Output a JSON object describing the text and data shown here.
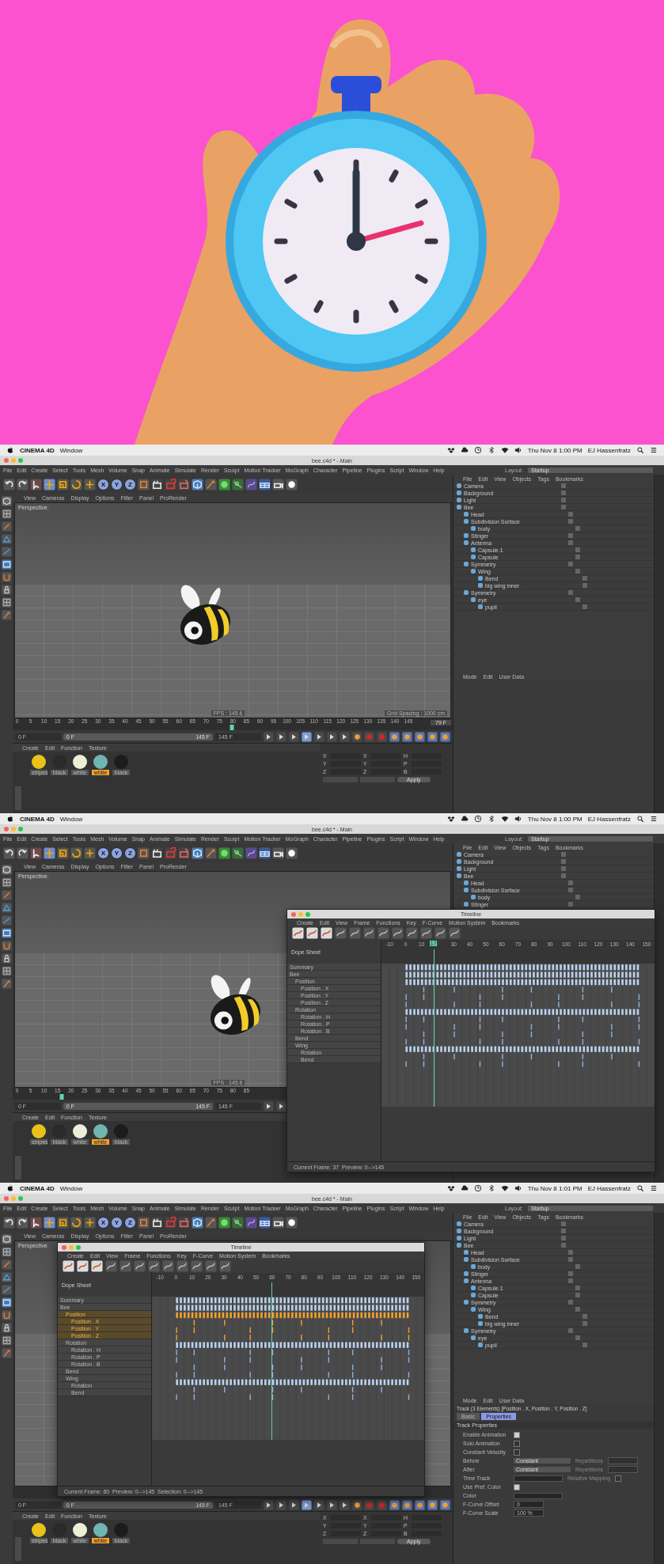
{
  "screens": [
    {
      "system_bar": {
        "app": "CINEMA 4D",
        "menu": "Window",
        "clock": "Thu Nov 8  1:00 PM",
        "user": "EJ Hassenfratz"
      },
      "title": "bee.c4d * - Main",
      "menus": [
        "File",
        "Edit",
        "Create",
        "Select",
        "Tools",
        "Mesh",
        "Volume",
        "Snap",
        "Animate",
        "Simulate",
        "Render",
        "Sculpt",
        "Motion Tracker",
        "MoGraph",
        "Character",
        "Pipeline",
        "Plugins",
        "Script",
        "Window",
        "Help"
      ],
      "layout": {
        "label": "Layout:",
        "value": "Startup"
      },
      "axis_buttons": [
        "X",
        "Y",
        "Z"
      ],
      "viewport": {
        "menus": [
          "View",
          "Cameras",
          "Display",
          "Options",
          "Filter",
          "Panel",
          "ProRender"
        ],
        "camera": "Perspective",
        "fps": "FPS : 145.6",
        "grid": "Grid Spacing : 1000 cm"
      },
      "ruler": {
        "ticks": [
          "0",
          "5",
          "10",
          "15",
          "20",
          "25",
          "30",
          "35",
          "40",
          "45",
          "50",
          "55",
          "60",
          "65",
          "70",
          "75",
          "80",
          "85",
          "90",
          "95",
          "100",
          "105",
          "110",
          "115",
          "120",
          "125",
          "130",
          "135",
          "140",
          "145"
        ],
        "current": "79 F",
        "level": 0.53
      },
      "transport": {
        "start": "0 F",
        "range_start": "0 F",
        "range_end": "145 F",
        "end": "145 F",
        "level": 1
      },
      "materials": {
        "menus": [
          "Create",
          "Edit",
          "Function",
          "Texture"
        ],
        "items": [
          {
            "name": "stripes",
            "color": "#e8c21a",
            "selected": false
          },
          {
            "name": "black",
            "color": "#2a2a2a",
            "selected": false
          },
          {
            "name": "white",
            "color": "#eeeed8",
            "selected": false
          },
          {
            "name": "white",
            "color": "#6fb5b0",
            "selected": true
          },
          {
            "name": "black",
            "color": "#1c1c1c",
            "selected": false
          }
        ]
      },
      "coords": {
        "rows": [
          [
            "X",
            "X",
            "H"
          ],
          [
            "Y",
            "Y",
            "P"
          ],
          [
            "Z",
            "Z",
            "B"
          ]
        ],
        "apply": "Apply"
      },
      "objects": {
        "menus": [
          "File",
          "Edit",
          "View",
          "Objects",
          "Tags",
          "Bookmarks"
        ],
        "tree": [
          {
            "name": "Camera"
          },
          {
            "name": "Background"
          },
          {
            "name": "Light"
          },
          {
            "name": "Bee",
            "children": [
              {
                "name": "Head"
              },
              {
                "name": "Subdivision Surface",
                "children": [
                  {
                    "name": "body"
                  }
                ]
              },
              {
                "name": "Stinger"
              },
              {
                "name": "Antenna",
                "children": [
                  {
                    "name": "Capsule.1"
                  },
                  {
                    "name": "Capsule"
                  }
                ]
              },
              {
                "name": "Symmetry",
                "children": [
                  {
                    "name": "Wing",
                    "children": [
                      {
                        "name": "Bend"
                      },
                      {
                        "name": "big wing inner"
                      }
                    ]
                  }
                ]
              },
              {
                "name": "Symmetry",
                "children": [
                  {
                    "name": "eye",
                    "children": [
                      {
                        "name": "pupil"
                      }
                    ]
                  }
                ]
              }
            ]
          }
        ]
      },
      "attributes": {
        "menus": [
          "Mode",
          "Edit",
          "User Data"
        ]
      }
    },
    {
      "system_bar": {
        "app": "CINEMA 4D",
        "menu": "Window",
        "clock": "Thu Nov 8  1:00 PM",
        "user": "EJ Hassenfratz"
      },
      "title": "bee.c4d * - Main",
      "menus": [
        "File",
        "Edit",
        "Create",
        "Select",
        "Tools",
        "Mesh",
        "Volume",
        "Snap",
        "Animate",
        "Simulate",
        "Render",
        "Sculpt",
        "Motion Tracker",
        "MoGraph",
        "Character",
        "Pipeline",
        "Plugins",
        "Script",
        "Window",
        "Help"
      ],
      "layout": {
        "label": "Layout:",
        "value": "Startup"
      },
      "axis_buttons": [
        "X",
        "Y",
        "Z"
      ],
      "viewport": {
        "menus": [
          "View",
          "Cameras",
          "Display",
          "Options",
          "Filter",
          "Panel",
          "ProRender"
        ],
        "camera": "Perspective",
        "fps": "FPS : 145.6"
      },
      "ruler": {
        "ticks": [
          "0",
          "5",
          "10",
          "15",
          "20",
          "25",
          "30",
          "35",
          "40",
          "45",
          "50",
          "55",
          "60",
          "65",
          "70",
          "75",
          "80",
          "85"
        ],
        "level": 0.11
      },
      "transport": {
        "start": "0 F",
        "range_start": "0 F",
        "range_end": "145 F",
        "end": "145 F",
        "level": 1
      },
      "materials": {
        "menus": [
          "Create",
          "Edit",
          "Function",
          "Texture"
        ],
        "items": [
          {
            "name": "stripes",
            "color": "#e8c21a",
            "selected": false
          },
          {
            "name": "black",
            "color": "#2a2a2a",
            "selected": false
          },
          {
            "name": "white",
            "color": "#eeeed8",
            "selected": false
          },
          {
            "name": "white",
            "color": "#6fb5b0",
            "selected": true
          },
          {
            "name": "black",
            "color": "#1c1c1c",
            "selected": false
          }
        ]
      },
      "objects": {
        "menus": [
          "File",
          "Edit",
          "View",
          "Objects",
          "Tags",
          "Bookmarks"
        ],
        "tree": [
          {
            "name": "Camera"
          },
          {
            "name": "Background"
          },
          {
            "name": "Light"
          },
          {
            "name": "Bee",
            "children": [
              {
                "name": "Head"
              },
              {
                "name": "Subdivision Surface",
                "children": [
                  {
                    "name": "body"
                  }
                ]
              },
              {
                "name": "Stinger"
              }
            ]
          }
        ]
      },
      "timeline": {
        "title": "Timeline",
        "menus": [
          "Create",
          "Edit",
          "View",
          "Frame",
          "Functions",
          "Key",
          "F-Curve",
          "Motion System",
          "Bookmarks"
        ],
        "section": "Dope Sheet",
        "ticks": [
          "-10",
          "0",
          "10",
          "30",
          "40",
          "50",
          "60",
          "70",
          "80",
          "90",
          "100",
          "110",
          "120",
          "130",
          "140",
          "150"
        ],
        "marker": "17",
        "level": 0.19,
        "tracks": [
          {
            "name": "Summary",
            "selected": false
          },
          {
            "name": "Bee",
            "selected": false,
            "children": [
              {
                "name": "Position",
                "selected": false,
                "children": [
                  {
                    "name": "Position . X",
                    "selected": false
                  },
                  {
                    "name": "Position . Y",
                    "selected": false
                  },
                  {
                    "name": "Position . Z",
                    "selected": false
                  }
                ]
              },
              {
                "name": "Rotation",
                "selected": false,
                "children": [
                  {
                    "name": "Rotation . H",
                    "selected": false
                  },
                  {
                    "name": "Rotation . P",
                    "selected": false
                  },
                  {
                    "name": "Rotation . B",
                    "selected": false
                  }
                ]
              },
              {
                "name": "Bend",
                "selected": false
              },
              {
                "name": "Wing",
                "selected": false,
                "children": [
                  {
                    "name": "Rotation",
                    "selected": false
                  },
                  {
                    "name": "Bend",
                    "selected": false
                  }
                ]
              }
            ]
          }
        ],
        "footer": "Current Frame: 37  Preview: 0-->145"
      }
    },
    {
      "system_bar": {
        "app": "CINEMA 4D",
        "menu": "Window",
        "clock": "Thu Nov 8  1:01 PM",
        "user": "EJ Hassenfratz"
      },
      "title": "bee.c4d * - Main",
      "menus": [
        "File",
        "Edit",
        "Create",
        "Select",
        "Tools",
        "Mesh",
        "Volume",
        "Snap",
        "Animate",
        "Simulate",
        "Render",
        "Sculpt",
        "Motion Tracker",
        "MoGraph",
        "Character",
        "Pipeline",
        "Plugins",
        "Script",
        "Window",
        "Help"
      ],
      "layout": {
        "label": "Layout:",
        "value": "Startup"
      },
      "axis_buttons": [
        "X",
        "Y",
        "Z"
      ],
      "viewport": {
        "menus": [
          "View",
          "Cameras",
          "Display",
          "Options",
          "Filter",
          "Panel",
          "ProRender"
        ],
        "camera": "Perspective"
      },
      "transport": {
        "start": "0 F",
        "range_start": "0 F",
        "range_end": "145 F",
        "end": "145 F",
        "level": 1
      },
      "materials": {
        "menus": [
          "Create",
          "Edit",
          "Function",
          "Texture"
        ],
        "items": [
          {
            "name": "stripes",
            "color": "#e8c21a",
            "selected": false
          },
          {
            "name": "black",
            "color": "#2a2a2a",
            "selected": false
          },
          {
            "name": "white",
            "color": "#eeeed8",
            "selected": false
          },
          {
            "name": "white",
            "color": "#6fb5b0",
            "selected": true
          },
          {
            "name": "black",
            "color": "#1c1c1c",
            "selected": false
          }
        ]
      },
      "coords": {
        "rows": [
          [
            "X",
            "X",
            "H"
          ],
          [
            "Y",
            "Y",
            "P"
          ],
          [
            "Z",
            "Z",
            "B"
          ]
        ],
        "apply": "Apply"
      },
      "objects": {
        "menus": [
          "File",
          "Edit",
          "View",
          "Objects",
          "Tags",
          "Bookmarks"
        ],
        "tree": [
          {
            "name": "Camera"
          },
          {
            "name": "Background"
          },
          {
            "name": "Light"
          },
          {
            "name": "Bee",
            "children": [
              {
                "name": "Head"
              },
              {
                "name": "Subdivision Surface",
                "children": [
                  {
                    "name": "body"
                  }
                ]
              },
              {
                "name": "Stinger"
              },
              {
                "name": "Antenna",
                "children": [
                  {
                    "name": "Capsule.1"
                  },
                  {
                    "name": "Capsule"
                  }
                ]
              },
              {
                "name": "Symmetry",
                "children": [
                  {
                    "name": "Wing",
                    "children": [
                      {
                        "name": "Bend"
                      },
                      {
                        "name": "big wing inner"
                      }
                    ]
                  }
                ]
              },
              {
                "name": "Symmetry",
                "children": [
                  {
                    "name": "eye",
                    "children": [
                      {
                        "name": "pupil"
                      }
                    ]
                  }
                ]
              }
            ]
          }
        ]
      },
      "attributes": {
        "menus": [
          "Mode",
          "Edit",
          "User Data"
        ],
        "title": "Track (3 Elements) [Position . X, Position . Y, Position . Z]",
        "tabs": [
          {
            "label": "Basic",
            "selected": false
          },
          {
            "label": "Properties",
            "selected": true
          }
        ],
        "section": "Track Properties",
        "fields": [
          {
            "kind": "check",
            "label": "Enable Animation",
            "checked": true
          },
          {
            "kind": "check",
            "label": "Solo Animation",
            "checked": false
          },
          {
            "kind": "check",
            "label": "Constant Velocity",
            "checked": false
          },
          {
            "kind": "select",
            "label": "Before",
            "value": "Constant",
            "extra": "Repetitions"
          },
          {
            "kind": "select",
            "label": "After",
            "value": "Constant",
            "extra": "Repetitions"
          },
          {
            "kind": "track",
            "label": "Time Track",
            "extra": "Relative Mapping",
            "checked": false
          },
          {
            "kind": "check",
            "label": "Use Pref. Color",
            "checked": true
          },
          {
            "kind": "color",
            "label": "Color"
          },
          {
            "kind": "number",
            "label": "F-Curve Offset",
            "value": "0"
          },
          {
            "kind": "number",
            "label": "F-Curve Scale",
            "value": "100 %"
          }
        ]
      },
      "timeline": {
        "title": "Timeline",
        "menus": [
          "Create",
          "Edit",
          "View",
          "Frame",
          "Functions",
          "Key",
          "F-Curve",
          "Motion System",
          "Bookmarks"
        ],
        "section": "Dope Sheet",
        "ticks": [
          "-10",
          "0",
          "10",
          "20",
          "30",
          "40",
          "50",
          "60",
          "70",
          "80",
          "90",
          "100",
          "110",
          "120",
          "130",
          "140",
          "150"
        ],
        "level": 0.44,
        "tracks": [
          {
            "name": "Summary",
            "selected": false
          },
          {
            "name": "Bee",
            "selected": false,
            "children": [
              {
                "name": "Position",
                "selected": true,
                "children": [
                  {
                    "name": "Position . X",
                    "selected": true
                  },
                  {
                    "name": "Position . Y",
                    "selected": true
                  },
                  {
                    "name": "Position . Z",
                    "selected": true
                  }
                ]
              },
              {
                "name": "Rotation",
                "selected": false,
                "children": [
                  {
                    "name": "Rotation . H",
                    "selected": false
                  },
                  {
                    "name": "Rotation . P",
                    "selected": false
                  },
                  {
                    "name": "Rotation . B",
                    "selected": false
                  }
                ]
              },
              {
                "name": "Bend",
                "selected": false
              },
              {
                "name": "Wing",
                "selected": false,
                "children": [
                  {
                    "name": "Rotation",
                    "selected": false
                  },
                  {
                    "name": "Bend",
                    "selected": false
                  }
                ]
              }
            ]
          }
        ],
        "footer": "Current Frame: 60  Preview: 0-->145  Selection: 0-->145"
      }
    }
  ]
}
